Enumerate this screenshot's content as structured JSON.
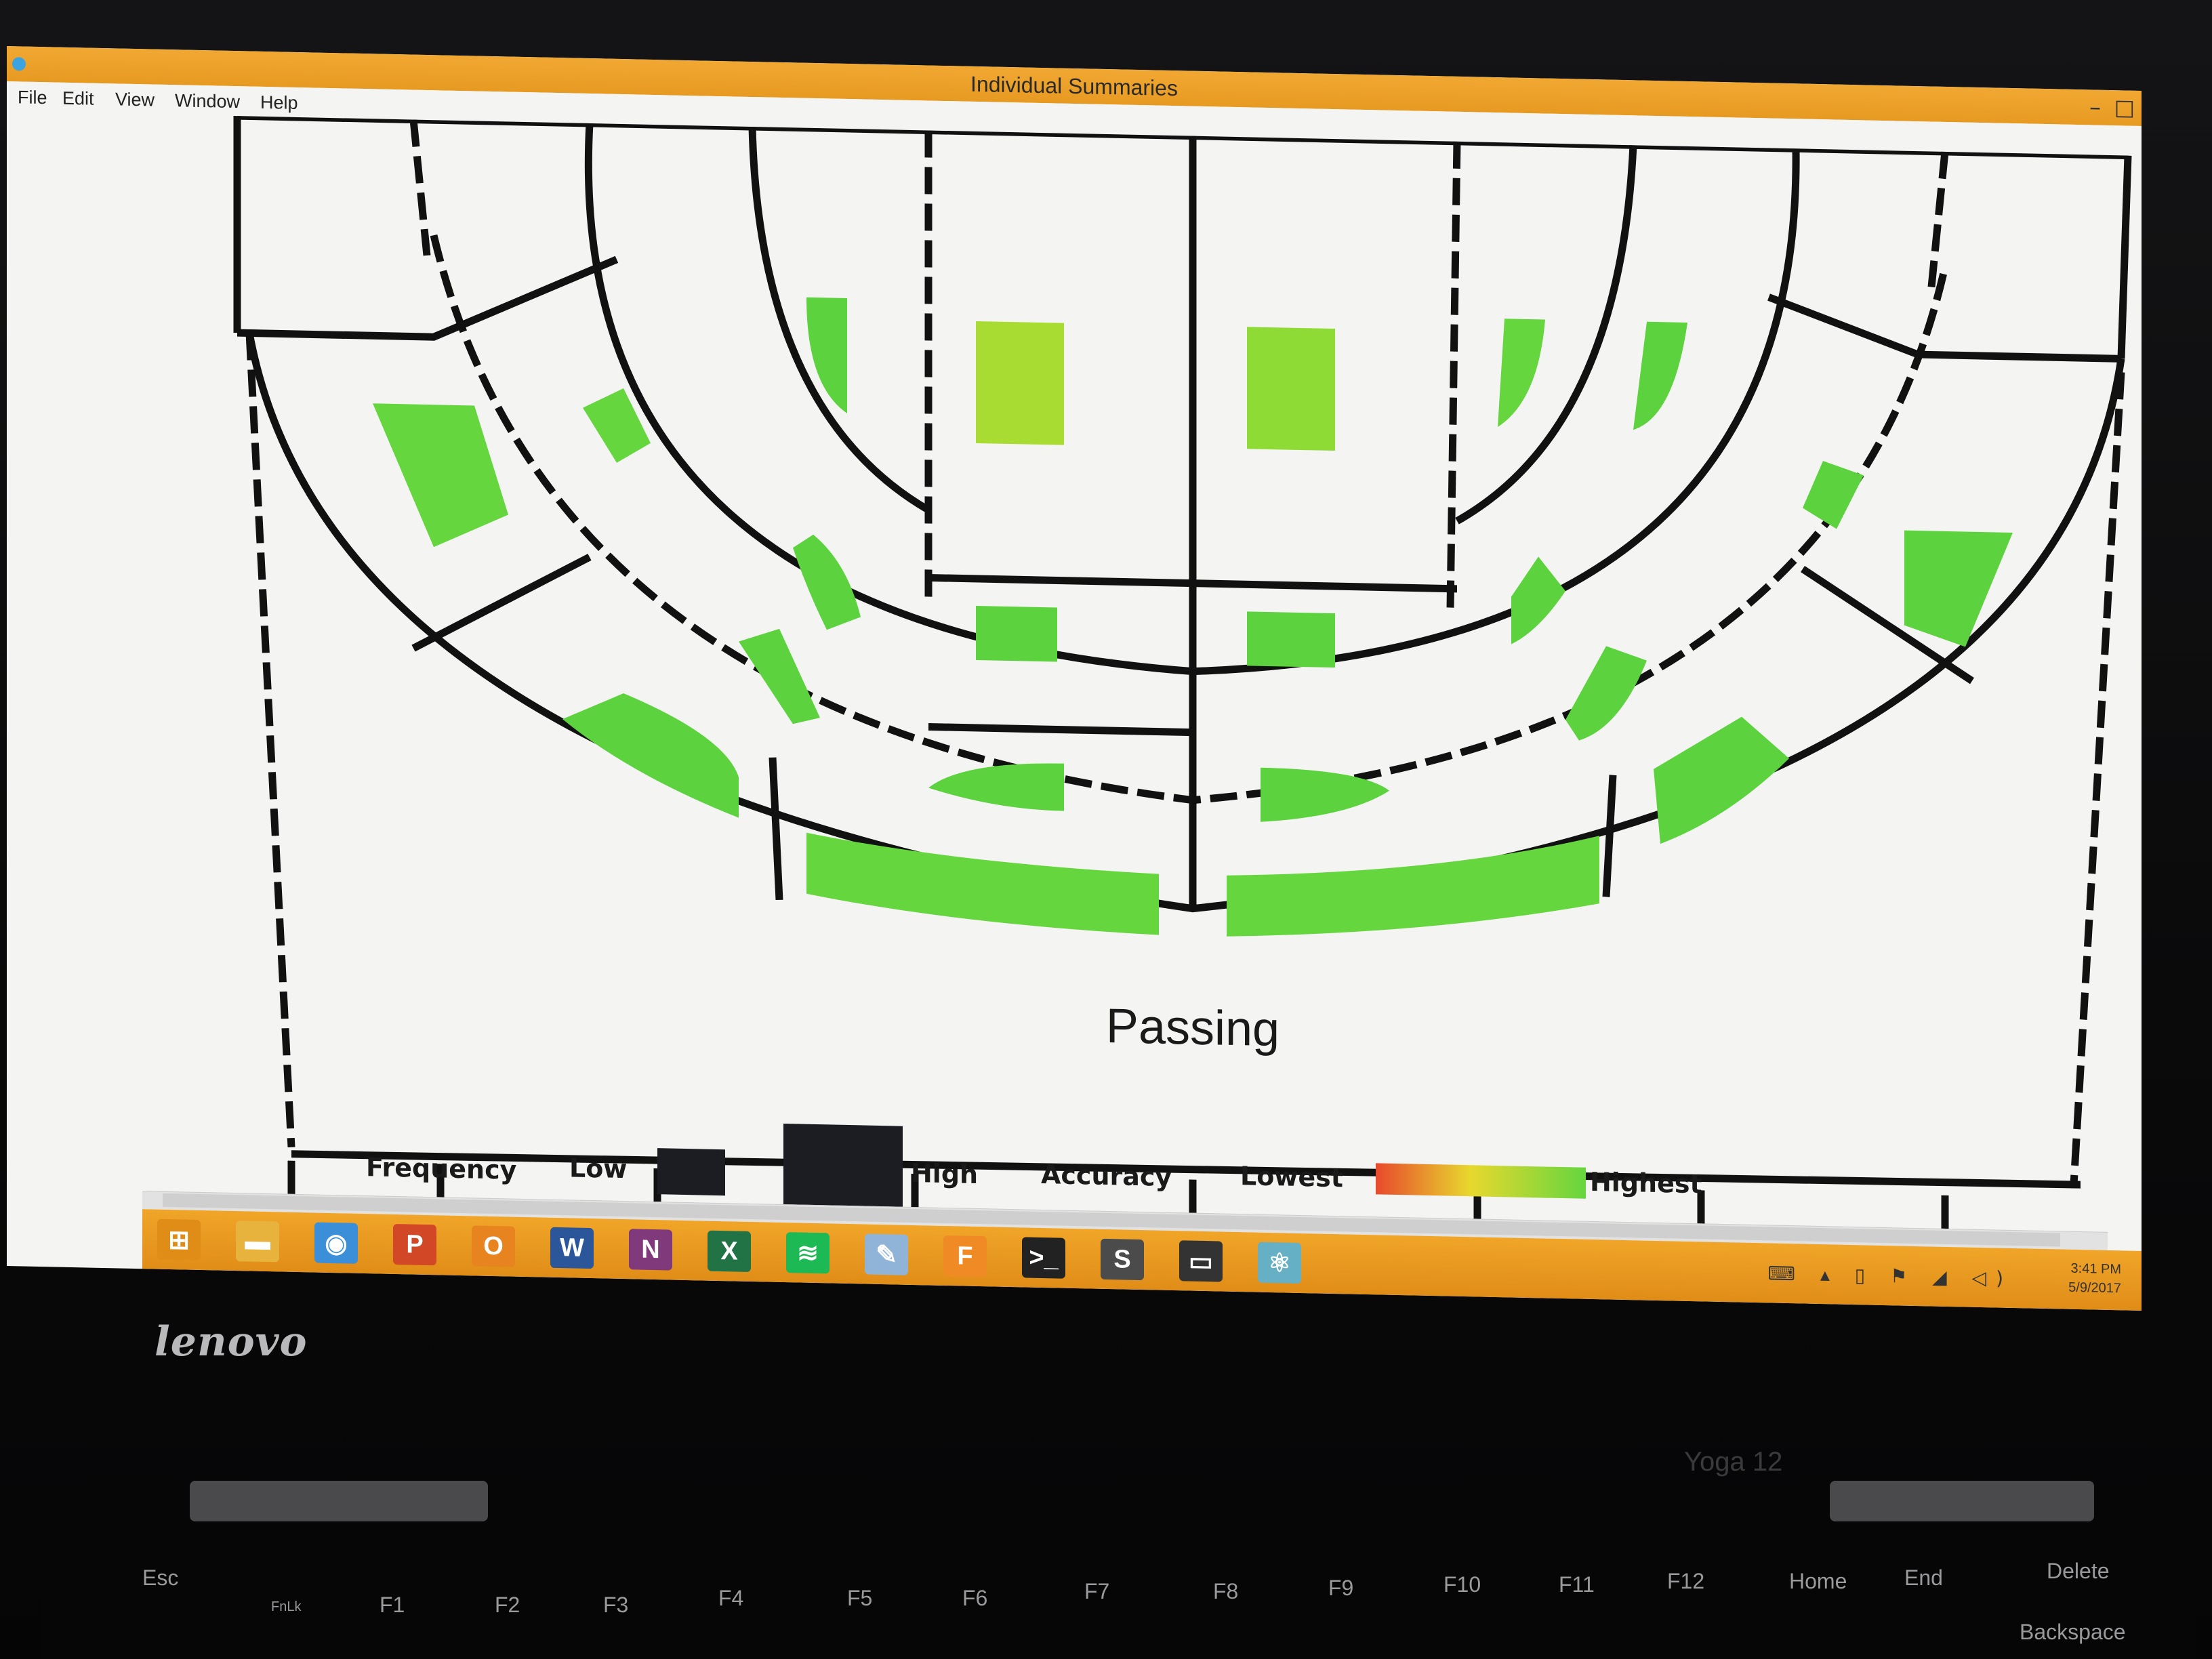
{
  "window": {
    "title": "Individual Summaries",
    "min_glyph": "–",
    "max_glyph": "□"
  },
  "menu": [
    "File",
    "Edit",
    "View",
    "Window",
    "Help"
  ],
  "chart_data": {
    "type": "heatmap",
    "title": "Passing",
    "legend": {
      "frequency_label": "Frequency",
      "low_label": "Low",
      "high_label": "High",
      "accuracy_label": "Accuracy",
      "lowest_label": "Lowest",
      "highest_label": "Highest",
      "gradient_colors": [
        "#e8492c",
        "#e8d82e",
        "#66d63f"
      ]
    },
    "zones": [
      {
        "zone": "left-wing-upper",
        "accuracy_color": "#66d63f"
      },
      {
        "zone": "left-slot-upper",
        "accuracy_color": "#66d63f"
      },
      {
        "zone": "left-slot-arc-top",
        "accuracy_color": "#5cd33e"
      },
      {
        "zone": "center-left-top",
        "accuracy_color": "#a9dc32"
      },
      {
        "zone": "center-right-top",
        "accuracy_color": "#8fdb36"
      },
      {
        "zone": "right-slot-arc-top",
        "accuracy_color": "#66d63f"
      },
      {
        "zone": "right-slot-arc-top-2",
        "accuracy_color": "#5cd33e"
      },
      {
        "zone": "right-slot-upper",
        "accuracy_color": "#5cd33e"
      },
      {
        "zone": "right-wing-upper",
        "accuracy_color": "#5cd33e"
      },
      {
        "zone": "left-mid-arc",
        "accuracy_color": "#5cd33e"
      },
      {
        "zone": "left-inner-arc",
        "accuracy_color": "#5cd33e"
      },
      {
        "zone": "center-left-mid",
        "accuracy_color": "#5cd33e"
      },
      {
        "zone": "center-right-mid",
        "accuracy_color": "#5cd33e"
      },
      {
        "zone": "right-inner-arc",
        "accuracy_color": "#5cd33e"
      },
      {
        "zone": "right-mid-arc",
        "accuracy_color": "#5cd33e"
      },
      {
        "zone": "left-lower-arc",
        "accuracy_color": "#5cd33e"
      },
      {
        "zone": "center-left-low",
        "accuracy_color": "#5cd33e"
      },
      {
        "zone": "center-right-low",
        "accuracy_color": "#5cd33e"
      },
      {
        "zone": "right-lower-arc",
        "accuracy_color": "#5cd33e"
      },
      {
        "zone": "left-bottom-band",
        "accuracy_color": "#66d63f"
      },
      {
        "zone": "right-bottom-band",
        "accuracy_color": "#66d63f"
      }
    ]
  },
  "taskbar": {
    "apps": [
      {
        "name": "windows-start-icon",
        "glyph": "⊞",
        "color": "#e08d18"
      },
      {
        "name": "file-explorer-icon",
        "glyph": "▬",
        "color": "#e8b33c"
      },
      {
        "name": "chrome-icon",
        "glyph": "◉",
        "color": "#3b8ed8"
      },
      {
        "name": "powerpoint-icon",
        "glyph": "P",
        "color": "#d24726"
      },
      {
        "name": "outlook-icon",
        "glyph": "O",
        "color": "#e8841f"
      },
      {
        "name": "word-icon",
        "glyph": "W",
        "color": "#2b579a"
      },
      {
        "name": "onenote-icon",
        "glyph": "N",
        "color": "#80397b"
      },
      {
        "name": "excel-icon",
        "glyph": "X",
        "color": "#217346"
      },
      {
        "name": "spotify-icon",
        "glyph": "≋",
        "color": "#1db954"
      },
      {
        "name": "notepad-icon",
        "glyph": "✎",
        "color": "#8fb4d8"
      },
      {
        "name": "f-app-icon",
        "glyph": "F",
        "color": "#f08a24"
      },
      {
        "name": "terminal-icon",
        "glyph": ">_",
        "color": "#222222"
      },
      {
        "name": "sublime-icon",
        "glyph": "S",
        "color": "#4b4b4b"
      },
      {
        "name": "console-icon",
        "glyph": "▭",
        "color": "#333333"
      },
      {
        "name": "atom-icon",
        "glyph": "⚛",
        "color": "#66b0c6"
      }
    ],
    "time": "3:41 PM",
    "date": "5/9/2017",
    "tray_glyphs": "⌨ ▴ ▯ ⚑ ◢ ◁)"
  },
  "laptop": {
    "brand": "lenovo",
    "model": "Yoga 12"
  },
  "keyboard": {
    "keys": [
      "Esc",
      "FnLk",
      "F1",
      "F2",
      "F3",
      "F4",
      "F5",
      "F6",
      "F7",
      "F8",
      "F9",
      "F10",
      "F11",
      "F12",
      "Home",
      "End",
      "Delete",
      "Backspace"
    ]
  }
}
